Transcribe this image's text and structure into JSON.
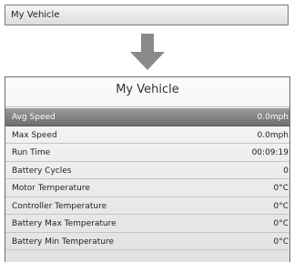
{
  "top_bar": {
    "label": "My Vehicle"
  },
  "icons": {
    "arrow": "down-arrow-icon"
  },
  "screen": {
    "title": "My Vehicle",
    "rows": [
      {
        "label": "Avg Speed",
        "value": "0.0mph",
        "selected": true
      },
      {
        "label": "Max Speed",
        "value": "0.0mph"
      },
      {
        "label": "Run Time",
        "value": "00:09:19"
      },
      {
        "label": "Battery Cycles",
        "value": "0"
      },
      {
        "label": "Motor Temperature",
        "value": "0°C"
      },
      {
        "label": "Controller Temperature",
        "value": "0°C"
      },
      {
        "label": "Battery Max Temperature",
        "value": "0°C"
      },
      {
        "label": "Battery Min Temperature",
        "value": "0°C"
      }
    ]
  }
}
